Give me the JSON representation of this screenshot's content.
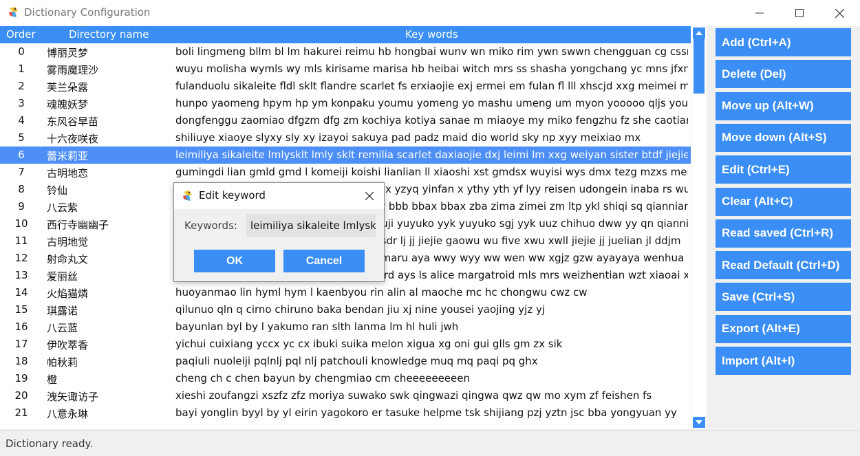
{
  "window": {
    "title": "Dictionary Configuration",
    "app_icon": "parrot-app-icon"
  },
  "table": {
    "columns": {
      "order": "Order",
      "name": "Directory name",
      "keywords": "Key words"
    },
    "selected_index": 6,
    "rows": [
      {
        "order": "0",
        "name": "博丽灵梦",
        "keywords": "boli lingmeng bllm bl lm hakurei reimu hb hongbai wunv wn miko rim ywn swwn chengguan cg cssrm"
      },
      {
        "order": "1",
        "name": "雾雨魔理沙",
        "keywords": "wuyu molisha wymls wy mls kirisame marisa hb heibai witch mrs ss shasha yongchang yc mns jfxnh mp"
      },
      {
        "order": "2",
        "name": "芙兰朵露",
        "keywords": "fulanduolu sikaleite fldl sklt flandre scarlet fs erxiaojie exj ermei em fulan fl lll xhscjd xxg meimei mm b"
      },
      {
        "order": "3",
        "name": "魂魄妖梦",
        "keywords": "hunpo yaomeng hpym hp ym konpaku youmu yomeng yo mashu umeng um myon yooooo qljs youmi"
      },
      {
        "order": "4",
        "name": "东风谷早苗",
        "keywords": "dongfenggu zaomiao dfgzm dfg zm kochiya kotiya sanae m miaoye my miko fengzhu fz she caotian c"
      },
      {
        "order": "5",
        "name": "十六夜咲夜",
        "keywords": "shiliuye xiaoye slyxy sly xy izayoi sakuya pad padz maid dio world sky np xyy meixiao mx"
      },
      {
        "order": "6",
        "name": "蕾米莉亚",
        "keywords": "leimiliya sikaleite lmlysklt lmly sklt remilia scarlet daxiaojie dxj leimi lm xxg weiyan sister btdf jiejie jj jiej"
      },
      {
        "order": "7",
        "name": "古明地恋",
        "keywords": "gumingdi lian gmld gmd l komeiji koishi lianlian ll xiaoshi xst gmdsx wuyisi wys dmx tezg mzxs meimei"
      },
      {
        "order": "8",
        "name": "铃仙",
        "keywords": "lingxian yinfan lingxianyuyuqiao lxyzyq lx yzyq yinfan x ythy yth yf lyy reisen udongein inaba rs wudong udon wd t"
      },
      {
        "order": "9",
        "name": "八云紫",
        "keywords": "bayun zi byz by z yakumo yukari xdzz zz bbb bbax bbax zba zima zimei zm ltp ykl shiqi sq qiannian qn jiejie jj"
      },
      {
        "order": "10",
        "name": "西行寺幽幽子",
        "keywords": "xixingsi youyouzi xxsyyz xxs yyz saigyouji yuyuko yyk yuyuko sgj yyk uuz chihuo dww yy qn qiannian ym youming"
      },
      {
        "order": "11",
        "name": "古明地觉",
        "keywords": "gumingdi jue gmdj gmd j komeiji satori sdr lj jj jiejie gaowu wu five xwu xwll jiejie jj juelian jl ddjm"
      },
      {
        "order": "12",
        "name": "射命丸文",
        "keywords": "shemingwan wen smww smw w shameimaru aya wwy wyy ww wen ww xgjz gzw ayayaya wenhua wh"
      },
      {
        "order": "13",
        "name": "爱丽丝",
        "keywords": "ailisi als alice margatroid mgtld mlx mgtrd ays ls alice margatroid mls mrs weizhentian wzt xiaoai xa renou ro yongc"
      },
      {
        "order": "14",
        "name": "火焰猫燐",
        "keywords": "huoyanmao lin hyml hym l kaenbyou rin alin al maoche mc hc chongwu cwz cw"
      },
      {
        "order": "15",
        "name": "琪露诺",
        "keywords": "qilunuo qln q cirno chiruno baka bendan jiu xj nine yousei yaojing yjz yj"
      },
      {
        "order": "16",
        "name": "八云蓝",
        "keywords": "bayunlan byl by l yakumo ran slth lanma lm hl huli jwh"
      },
      {
        "order": "17",
        "name": "伊吹萃香",
        "keywords": "yichui cuixiang yccx yc cx ibuki suika melon xigua xg oni gui glls gm zx sik"
      },
      {
        "order": "18",
        "name": "帕秋莉",
        "keywords": "paqiuli nuoleiji pqlnlj pql nlj patchouli knowledge muq mq paqi pq ghx"
      },
      {
        "order": "19",
        "name": "橙",
        "keywords": "cheng ch c chen bayun by chengmiao cm cheeeeeeeeen"
      },
      {
        "order": "20",
        "name": "洩矢诹访子",
        "keywords": "xieshi zoufangzi xszfz zfz moriya suwako swk qingwazi qingwa qwz qw mo xym zf feishen fs"
      },
      {
        "order": "21",
        "name": "八意永琳",
        "keywords": "bayi yonglin byyl by yl eirin yagokoro er tasuke helpme tsk shijiang pzj yztn jsc bba yongyuan yy"
      }
    ]
  },
  "sidebar": {
    "buttons": [
      "Add (Ctrl+A)",
      "Delete (Del)",
      "Move up (Alt+W)",
      "Move down (Alt+S)",
      "Edit (Ctrl+E)",
      "Clear (Alt+C)",
      "Read saved (Ctrl+R)",
      "Read Default (Ctrl+D)",
      "Save (Ctrl+S)",
      "Export (Alt+E)",
      "Import (Alt+I)"
    ]
  },
  "status": {
    "text": "Dictionary ready."
  },
  "dialog": {
    "title": "Edit keyword",
    "label": "Keywords:",
    "value": "leimiliya sikaleite lmlyskl",
    "ok": "OK",
    "cancel": "Cancel"
  },
  "colors": {
    "accent": "#3a8ef5",
    "selected_row": "#4e8ff7"
  }
}
